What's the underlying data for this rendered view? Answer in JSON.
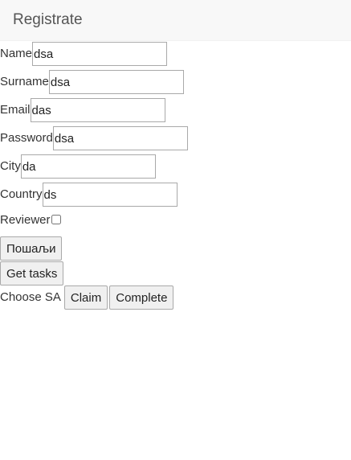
{
  "navbar": {
    "brand": "Registrate"
  },
  "form": {
    "fields": [
      {
        "label": "Name",
        "value": "dsa"
      },
      {
        "label": "Surname",
        "value": "dsa"
      },
      {
        "label": "Email",
        "value": "das"
      },
      {
        "label": "Password",
        "value": "dsa"
      },
      {
        "label": "City",
        "value": "da"
      },
      {
        "label": "Country",
        "value": "ds"
      }
    ],
    "reviewer": {
      "label": "Reviewer",
      "checked": false
    },
    "submit_label": "Пошаљи"
  },
  "tasks": {
    "get_tasks_label": "Get tasks",
    "choose_label": "Choose SA",
    "claim_label": "Claim",
    "complete_label": "Complete"
  }
}
